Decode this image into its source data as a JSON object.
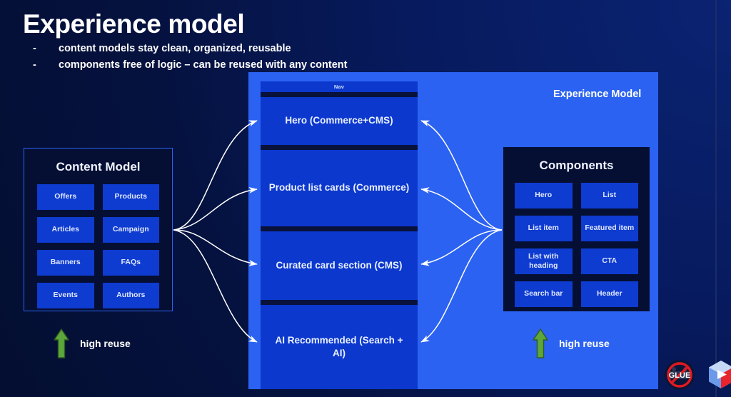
{
  "slide": {
    "title": "Experience model",
    "bullets": [
      {
        "dash": "-",
        "text": "content models stay clean, organized, reusable"
      },
      {
        "dash": "-",
        "text": "components free of logic – can be reused with any content"
      }
    ]
  },
  "experience_model": {
    "label": "Experience Model"
  },
  "page_mock": {
    "nav_label": "Nav",
    "sections": [
      {
        "label": "Hero (Commerce+CMS)"
      },
      {
        "label": "Product list cards (Commerce)"
      },
      {
        "label": "Curated card section (CMS)"
      },
      {
        "label": "AI Recommended (Search + AI)"
      }
    ]
  },
  "content_model": {
    "title": "Content Model",
    "items": [
      "Offers",
      "Products",
      "Articles",
      "Campaign",
      "Banners",
      "FAQs",
      "Events",
      "Authors"
    ]
  },
  "components": {
    "title": "Components",
    "items": [
      "Hero",
      "List",
      "List item",
      "Featured item",
      "List with heading",
      "CTA",
      "Search bar",
      "Header"
    ]
  },
  "reuse_markers": [
    {
      "label": "high reuse",
      "icon": "up-arrow-icon"
    },
    {
      "label": "high reuse",
      "icon": "up-arrow-icon"
    }
  ],
  "logos": [
    {
      "name": "no-glue-logo",
      "text": "GLUE"
    },
    {
      "name": "cube-logo",
      "text": ""
    }
  ],
  "colors": {
    "background": "#061b63",
    "panel_blue": "#2b62f2",
    "section_blue": "#0c38ce",
    "card_panel": "#050f33",
    "chip_blue": "#0e3bd0",
    "separator": "#08123a",
    "green": "#5ca63c",
    "text": "#ffffff"
  }
}
